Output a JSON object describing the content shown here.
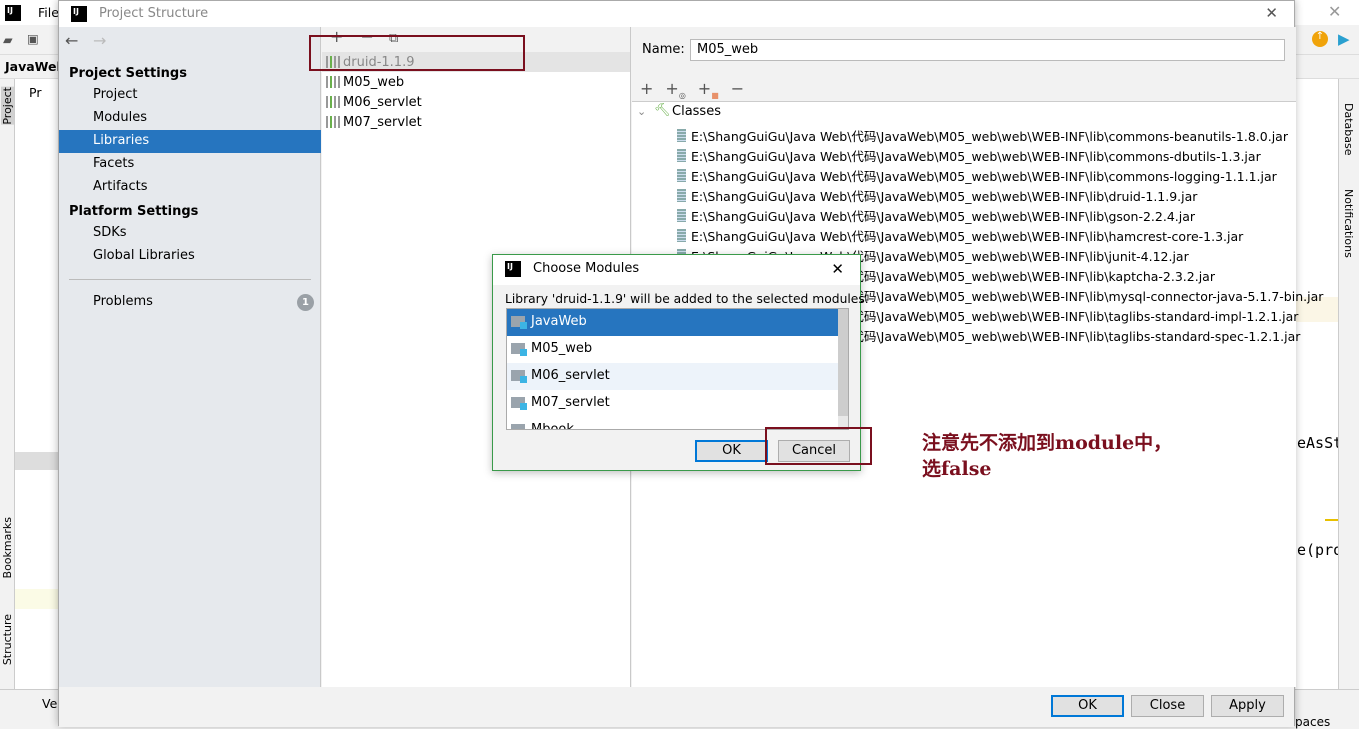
{
  "ide": {
    "menu_file": "File",
    "project_name": "JavaWeb",
    "proj_tab": "Pr",
    "left_tools": [
      "Project",
      "Bookmarks",
      "Structure"
    ],
    "right_tools": [
      "Database",
      "Notifications"
    ],
    "code_fragments": [
      "eAsSt",
      "e(pro"
    ],
    "status_left": "Ver",
    "status_right": "paces"
  },
  "dialog": {
    "title": "Project Structure",
    "nav": {
      "project_settings": "Project Settings",
      "items": [
        "Project",
        "Modules",
        "Libraries",
        "Facets",
        "Artifacts"
      ],
      "platform_settings": "Platform Settings",
      "platform_items": [
        "SDKs",
        "Global Libraries"
      ],
      "problems": "Problems",
      "problems_count": "1",
      "selected": "Libraries"
    },
    "libraries": [
      "druid-1.1.9",
      "M05_web",
      "M06_servlet",
      "M07_servlet"
    ],
    "name_label": "Name:",
    "name_value": "M05_web",
    "classes_label": "Classes",
    "class_paths": [
      "E:\\ShangGuiGu\\Java Web\\代码\\JavaWeb\\M05_web\\web\\WEB-INF\\lib\\commons-beanutils-1.8.0.jar",
      "E:\\ShangGuiGu\\Java Web\\代码\\JavaWeb\\M05_web\\web\\WEB-INF\\lib\\commons-dbutils-1.3.jar",
      "E:\\ShangGuiGu\\Java Web\\代码\\JavaWeb\\M05_web\\web\\WEB-INF\\lib\\commons-logging-1.1.1.jar",
      "E:\\ShangGuiGu\\Java Web\\代码\\JavaWeb\\M05_web\\web\\WEB-INF\\lib\\druid-1.1.9.jar",
      "E:\\ShangGuiGu\\Java Web\\代码\\JavaWeb\\M05_web\\web\\WEB-INF\\lib\\gson-2.2.4.jar",
      "E:\\ShangGuiGu\\Java Web\\代码\\JavaWeb\\M05_web\\web\\WEB-INF\\lib\\hamcrest-core-1.3.jar",
      "E:\\ShangGuiGu\\Java Web\\代码\\JavaWeb\\M05_web\\web\\WEB-INF\\lib\\junit-4.12.jar",
      "E:\\ShangGuiGu\\Java Web\\代码\\JavaWeb\\M05_web\\web\\WEB-INF\\lib\\kaptcha-2.3.2.jar",
      "E:\\ShangGuiGu\\Java Web\\代码\\JavaWeb\\M05_web\\web\\WEB-INF\\lib\\mysql-connector-java-5.1.7-bin.jar",
      "E:\\ShangGuiGu\\Java Web\\代码\\JavaWeb\\M05_web\\web\\WEB-INF\\lib\\taglibs-standard-impl-1.2.1.jar",
      "E:\\ShangGuiGu\\Java Web\\代码\\JavaWeb\\M05_web\\web\\WEB-INF\\lib\\taglibs-standard-spec-1.2.1.jar"
    ],
    "buttons": {
      "ok": "OK",
      "close": "Close",
      "apply": "Apply"
    }
  },
  "choose_modules": {
    "title": "Choose Modules",
    "message": "Library 'druid-1.1.9' will be added to the selected modules.",
    "modules": [
      "JavaWeb",
      "M05_web",
      "M06_servlet",
      "M07_servlet",
      "Mbook"
    ],
    "selected": "JavaWeb",
    "ok": "OK",
    "cancel": "Cancel"
  },
  "annotation": {
    "line1": "注意先不添加到module中，",
    "line2": "选false",
    "color": "#7a0f1e"
  },
  "colors": {
    "selection": "#2675bf",
    "accent_border": "#0078d7",
    "dialog_border": "#3a9a4a"
  }
}
